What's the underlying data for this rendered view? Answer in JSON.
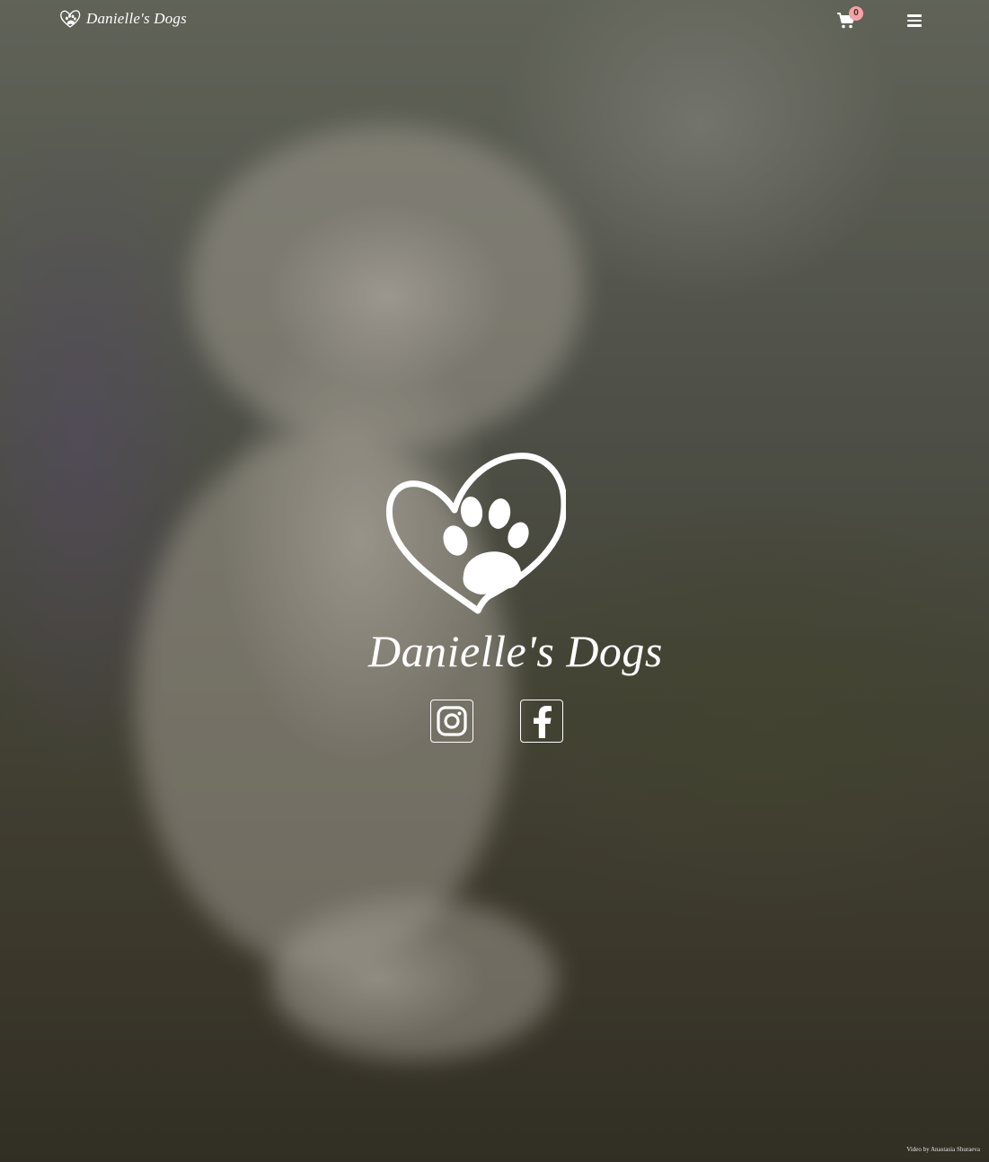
{
  "brand": {
    "name": "Danielle's Dogs"
  },
  "header": {
    "cart_count": "0",
    "cart_icon": "shopping-cart-icon",
    "menu_icon": "hamburger-menu-icon"
  },
  "hero": {
    "title": "Danielle's Dogs",
    "logo_icon": "heart-paw-icon"
  },
  "social": [
    {
      "name": "Instagram",
      "icon": "instagram-icon"
    },
    {
      "name": "Facebook",
      "icon": "facebook-icon"
    }
  ],
  "footer": {
    "credit": "Video by Anastasia Shuraeva"
  },
  "colors": {
    "text": "#ffffff",
    "badge": "#f3a3a8"
  }
}
